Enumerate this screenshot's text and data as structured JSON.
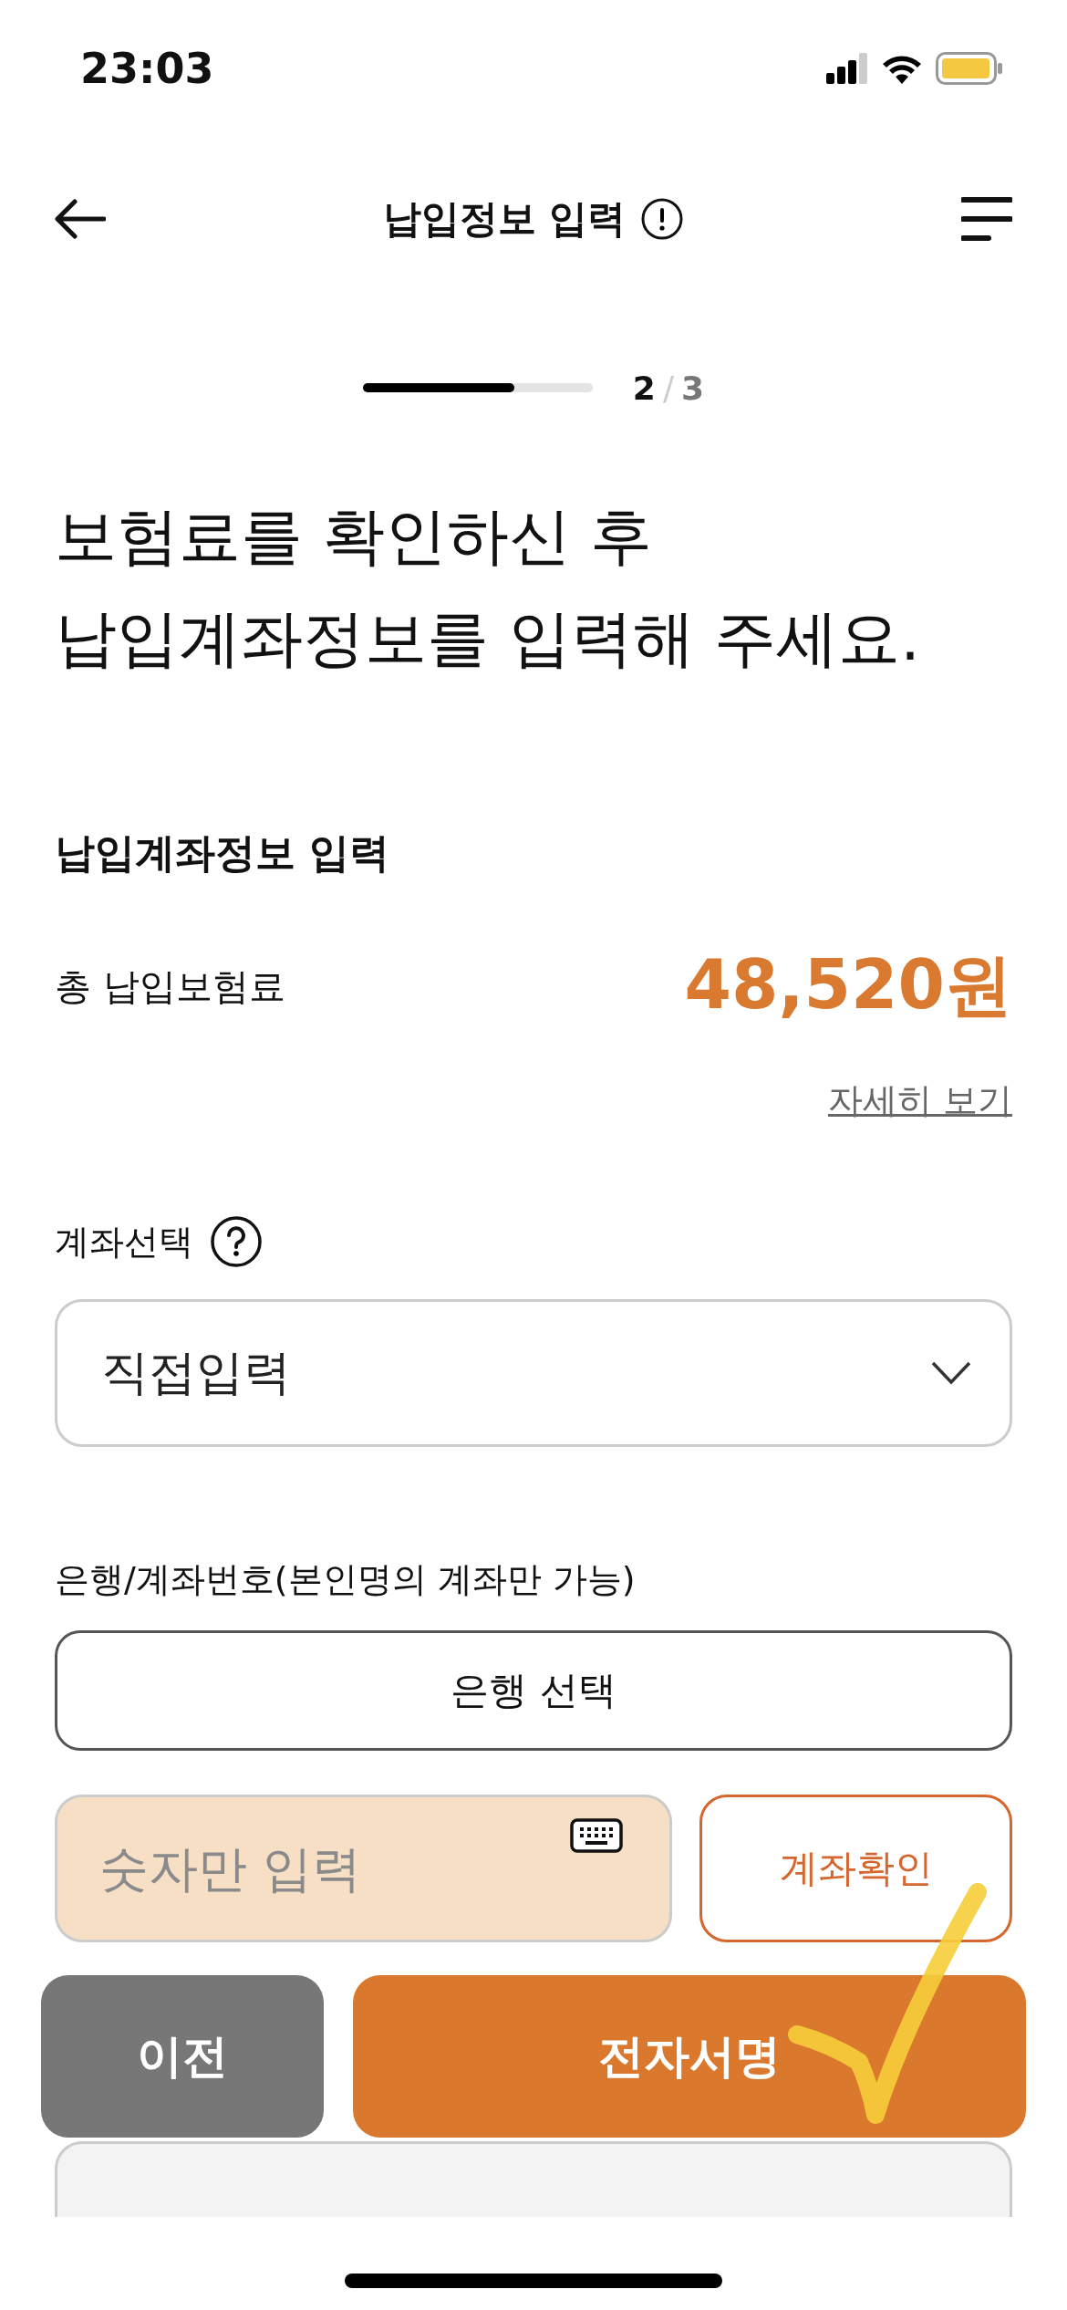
{
  "status_bar": {
    "time": "23:03"
  },
  "header": {
    "title": "납입정보 입력"
  },
  "progress": {
    "level": 0.66,
    "current": "2",
    "separator": "/",
    "total": "3"
  },
  "heading": [
    "보험료를 확인하신 후",
    "납입계좌정보를 입력해 주세요."
  ],
  "section_title": "납입계좌정보 입력",
  "total": {
    "label": "총 납입보험료",
    "amount": "48,520원"
  },
  "detail_link": "자세히 보기",
  "account_select": {
    "label": "계좌선택",
    "value": "직접입력"
  },
  "bank_account": {
    "label": "은행/계좌번호(본인명의 계좌만 가능)",
    "bank_button": "은행 선택",
    "number_placeholder": "숫자만 입력",
    "verify_button": "계좌확인"
  },
  "buttons": {
    "prev": "이전",
    "sign": "전자서명"
  }
}
